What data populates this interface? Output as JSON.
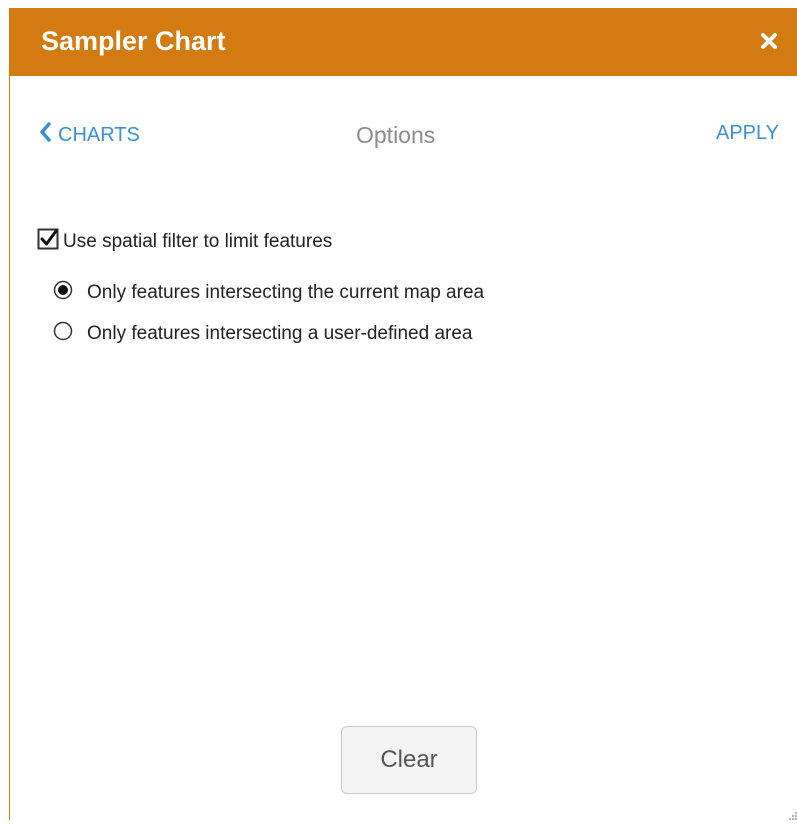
{
  "panel": {
    "title": "Sampler Chart",
    "close_icon": "close-icon",
    "accent_color": "#d37b10"
  },
  "nav": {
    "back_label": "CHARTS",
    "back_icon": "chevron-left-icon",
    "title": "Options",
    "apply_label": "APPLY",
    "link_color": "#3b8fd6"
  },
  "options": {
    "spatial_filter_label": "Use spatial filter to limit features",
    "spatial_filter_checked": true,
    "radio_options": [
      {
        "label": "Only features intersecting the current map area",
        "selected": true
      },
      {
        "label": "Only features intersecting a user-defined area",
        "selected": false
      }
    ]
  },
  "footer": {
    "clear_label": "Clear",
    "resize_icon": "resize-grip-icon"
  }
}
